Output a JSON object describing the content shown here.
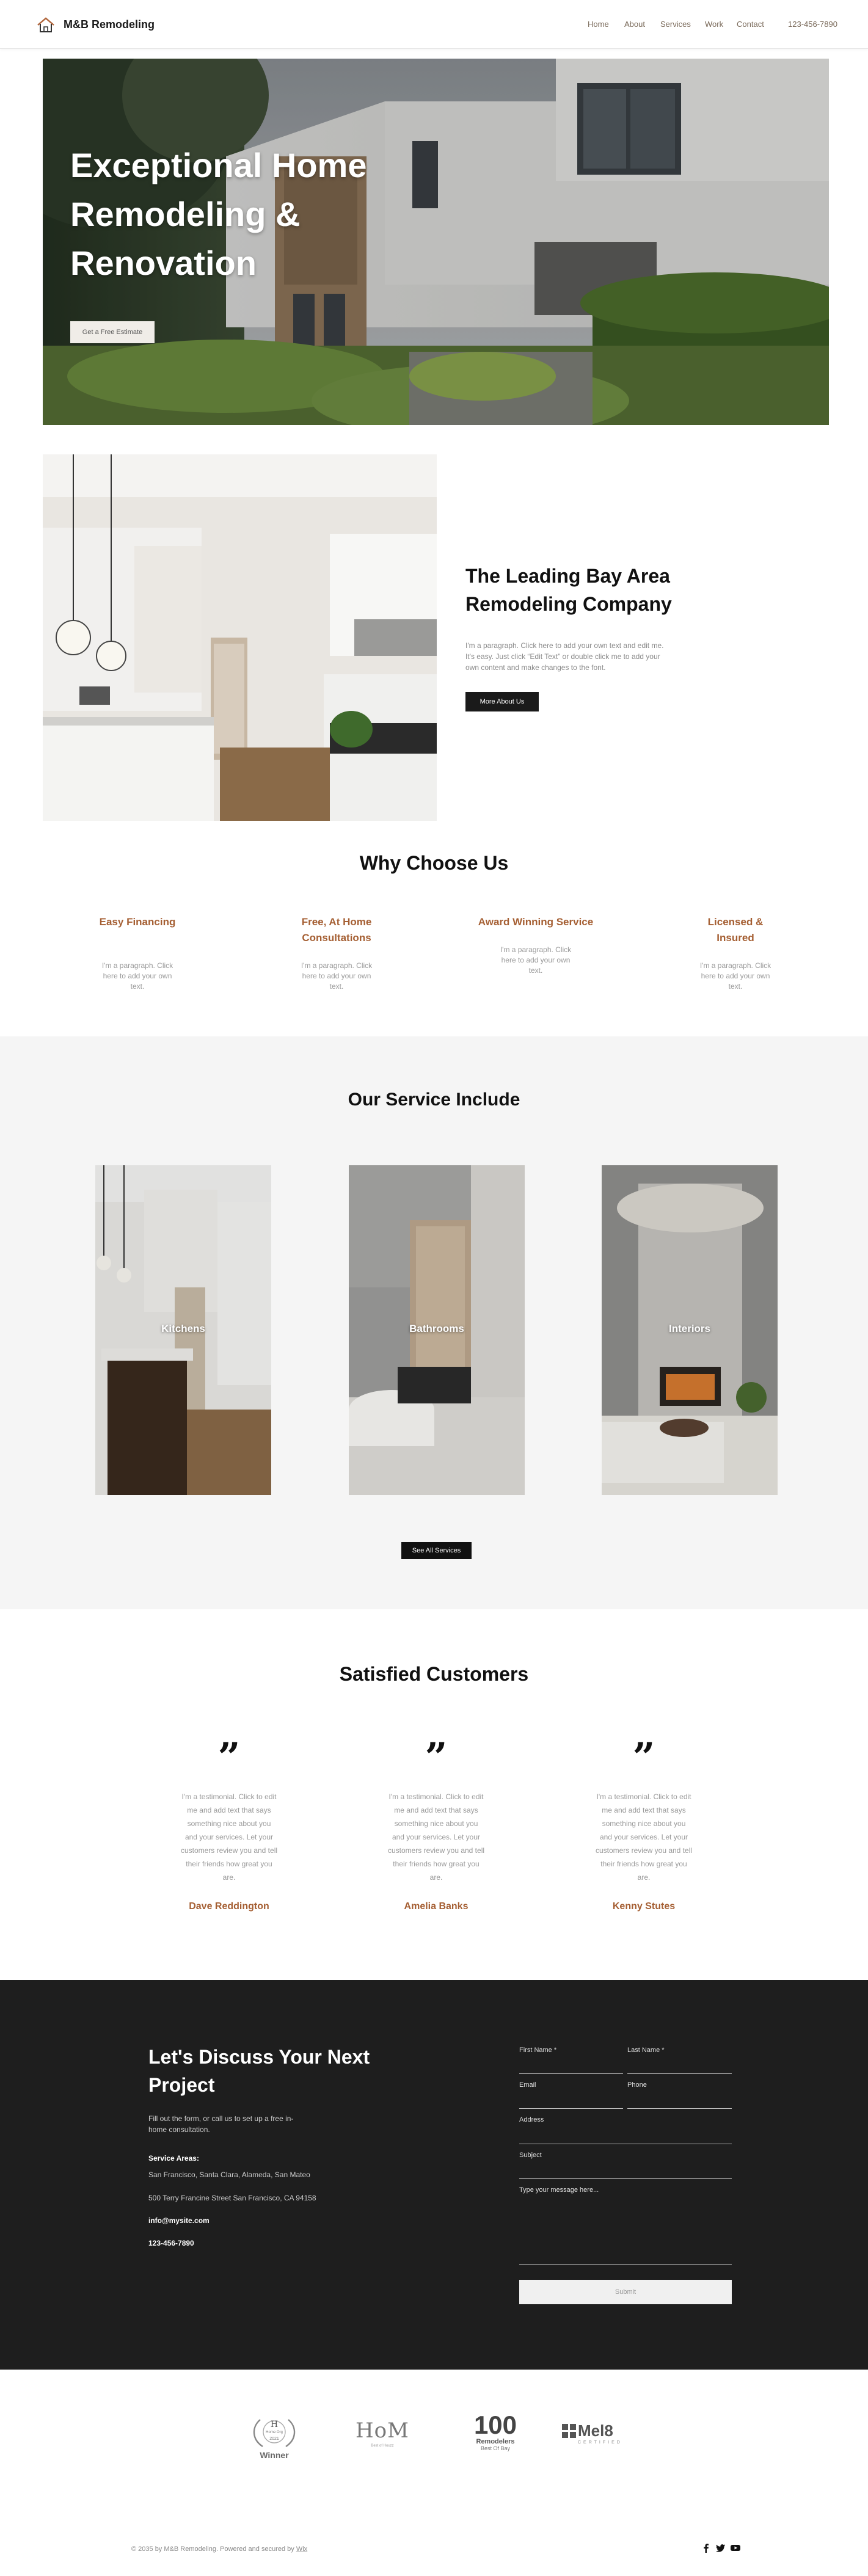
{
  "header": {
    "logo_text": "M&B Remodeling",
    "nav": [
      "Home",
      "About",
      "Services",
      "Work",
      "Contact"
    ],
    "phone": "123-456-7890"
  },
  "hero": {
    "title": "Exceptional Home Remodeling & Renovation",
    "button_label": "Get a Free Estimate"
  },
  "about": {
    "title": "The Leading Bay Area Remodeling Company",
    "text": "I'm a paragraph. Click here to add your own text and edit me. It's easy. Just click “Edit Text” or double click me to add your own content and make changes to the font.",
    "button_label": "More About Us"
  },
  "why": {
    "title": "Why Choose Us",
    "features": [
      {
        "title": "Easy Financing",
        "text": "I'm a paragraph. Click here to add your own text."
      },
      {
        "title": "Free, At Home Consultations",
        "text": "I'm a paragraph. Click here to add your own text."
      },
      {
        "title": "Award Winning Service",
        "text": "I'm a paragraph. Click here to add your own text."
      },
      {
        "title": "Licensed & Insured",
        "text": "I'm a paragraph. Click here to add your own text."
      }
    ]
  },
  "services": {
    "title": "Our Service Include",
    "items": [
      {
        "label": "Kitchens"
      },
      {
        "label": "Bathrooms"
      },
      {
        "label": "Interiors"
      }
    ],
    "button_label": "See All Services"
  },
  "testimonials": {
    "title": "Satisfied Customers",
    "quote_glyph": "”",
    "items": [
      {
        "text": "I'm a testimonial. Click to edit me and add text that says something nice about you and your services. Let your customers review you and tell their friends how great you are.",
        "name": "Dave Reddington"
      },
      {
        "text": "I'm a testimonial. Click to edit me and add text that says something nice about you and your services. Let your customers review you and tell their friends how great you are.",
        "name": "Amelia Banks"
      },
      {
        "text": "I'm a testimonial. Click to edit me and add text that says something nice about you and your services. Let your customers review you and tell their friends how great you are.",
        "name": "Kenny Stutes"
      }
    ]
  },
  "contact": {
    "title": "Let's Discuss Your Next Project",
    "subtitle": "Fill out the form, or call us to set up a free in-home consultation.",
    "areas_label": "Service Areas:",
    "areas": "San Francisco, Santa Clara, Alameda, San Mateo",
    "address": "500 Terry Francine Street San Francisco, CA 94158",
    "email": "info@mysite.com",
    "phone": "123-456-7890",
    "form": {
      "first_name": "First Name *",
      "last_name": "Last Name *",
      "email": "Email",
      "phone": "Phone",
      "address": "Address",
      "subject": "Subject",
      "message": "Type your message here...",
      "submit": "Submit"
    }
  },
  "awards": {
    "badge1_top": "H",
    "badge1_mid": "Home Org",
    "badge1_year": "2021",
    "badge1_label": "Winner",
    "badge2": "HoM",
    "badge2_sub": "Best of Houzz",
    "badge3_num": "100",
    "badge3_word": "Remodelers",
    "badge3_sub": "Best Of Bay",
    "badge4": "Mel8",
    "badge4_sub": "CERTIFIED"
  },
  "footer": {
    "text": "© 2035 by M&B Remodeling. Powered and secured by ",
    "link": "Wix"
  },
  "colors": {
    "accent": "#a55f33",
    "dark": "#1e1e1e",
    "light_bg": "#f5f5f5"
  }
}
